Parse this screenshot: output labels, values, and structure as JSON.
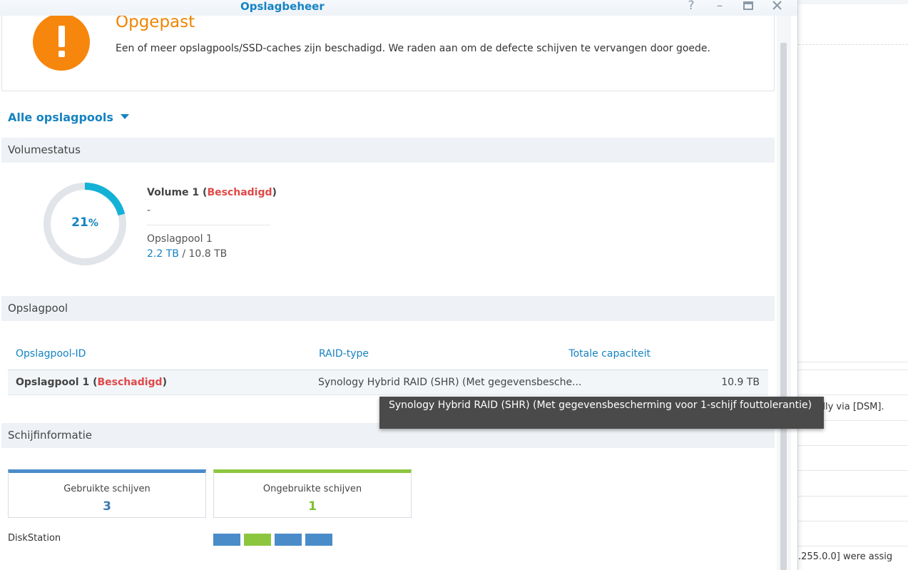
{
  "window": {
    "title": "Opslagbeheer"
  },
  "warning": {
    "title": "Opgepast",
    "text": "Een of meer opslagpools/SSD-caches zijn beschadigd. We raden aan om de defecte schijven te vervangen door goede."
  },
  "pool_selector": {
    "label": "Alle opslagpools"
  },
  "volume_status": {
    "header": "Volumestatus",
    "usage_percent": "21",
    "usage_unit": "%",
    "usage_fraction": 0.21,
    "volume_name": "Volume 1",
    "volume_state": "Beschadigd",
    "description": "-",
    "pool": "Opslagpool 1",
    "used": "2.2 TB",
    "separator": " / ",
    "total": "10.8 TB",
    "colors": {
      "used": "#14b1d6",
      "free": "#e1e4e8"
    }
  },
  "storage_pool": {
    "header": "Opslagpool",
    "columns": [
      "Opslagpool-ID",
      "RAID-type",
      "Totale capaciteit"
    ],
    "rows": [
      {
        "id": "Opslagpool 1",
        "state": "Beschadigd",
        "raid": "Synology Hybrid RAID (SHR) (Met gegevensbesche...",
        "capacity": "10.9 TB"
      }
    ]
  },
  "tooltip": {
    "text": "Synology Hybrid RAID (SHR) (Met gegevensbescherming voor 1-schijf fouttolerantie)"
  },
  "disk_info": {
    "header": "Schijfinformatie",
    "used_label": "Gebruikte schijven",
    "used_count": "3",
    "unused_label": "Ongebruikte schijven",
    "unused_count": "1",
    "device": "DiskStation",
    "colors": {
      "used": "#4a8cc9",
      "unused": "#8cc63f"
    },
    "slots": [
      "used",
      "unused",
      "used",
      "used"
    ]
  },
  "background_window": {
    "texts": [
      "essfully via [DSM].",
      ".255.0.0] were assig"
    ]
  }
}
